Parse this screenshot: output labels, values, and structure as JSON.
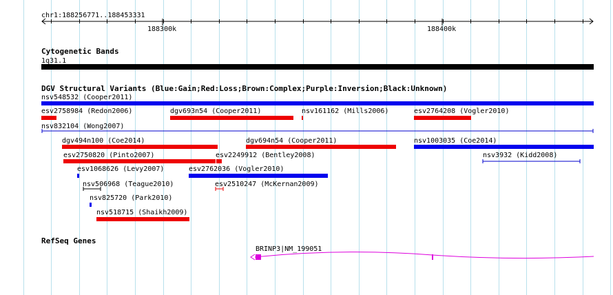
{
  "browser": {
    "range_label": "chr1:188256771..188453331",
    "ticks": [
      "188300k",
      "188400k"
    ],
    "grid_color": "#b8e0ec"
  },
  "tracks": {
    "cyto": {
      "title": "Cytogenetic Bands",
      "band_label": "1q31.1",
      "band_color": "#000000"
    },
    "dgv": {
      "title": "DGV Structural Variants (Blue:Gain;Red:Loss;Brown:Complex;Purple:Inversion;Black:Unknown)",
      "colors": {
        "gain": "#0000ee",
        "loss": "#ee0000",
        "unknown": "#0000cc"
      },
      "features": [
        {
          "label": "nsv548532 (Cooper2011)",
          "type": "gain",
          "style": "bar"
        },
        {
          "label": "esv2758984 (Redon2006)",
          "type": "loss",
          "style": "bar"
        },
        {
          "label": "dgv693n54 (Cooper2011)",
          "type": "loss",
          "style": "bar"
        },
        {
          "label": "nsv161162 (Mills2006)",
          "type": "loss",
          "style": "bar"
        },
        {
          "label": "esv2764208 (Vogler2010)",
          "type": "loss",
          "style": "bar"
        },
        {
          "label": "nsv832104 (Wong2007)",
          "type": "gain",
          "style": "line"
        },
        {
          "label": "dgv494n100 (Coe2014)",
          "type": "loss",
          "style": "bar"
        },
        {
          "label": "dgv694n54 (Cooper2011)",
          "type": "loss",
          "style": "bar"
        },
        {
          "label": "nsv1003035 (Coe2014)",
          "type": "gain",
          "style": "bar"
        },
        {
          "label": "esv2750820 (Pinto2007)",
          "type": "loss",
          "style": "bar"
        },
        {
          "label": "esv2249912 (Bentley2008)",
          "type": "loss",
          "style": "bar"
        },
        {
          "label": "nsv3932 (Kidd2008)",
          "type": "gain",
          "style": "line"
        },
        {
          "label": "esv1068626 (Levy2007)",
          "type": "gain",
          "style": "bar"
        },
        {
          "label": "esv2762036 (Vogler2010)",
          "type": "gain",
          "style": "bar"
        },
        {
          "label": "nsv506968 (Teague2010)",
          "type": "unknown",
          "style": "line"
        },
        {
          "label": "esv2510247 (McKernan2009)",
          "type": "loss",
          "style": "line"
        },
        {
          "label": "nsv825720 (Park2010)",
          "type": "gain",
          "style": "bar"
        },
        {
          "label": "nsv518715 (Shaikh2009)",
          "type": "loss",
          "style": "bar"
        }
      ]
    },
    "refseq": {
      "title": "RefSeq Genes",
      "gene_label": "BRINP3|NM_199051",
      "gene_color": "#dd00dd"
    }
  }
}
